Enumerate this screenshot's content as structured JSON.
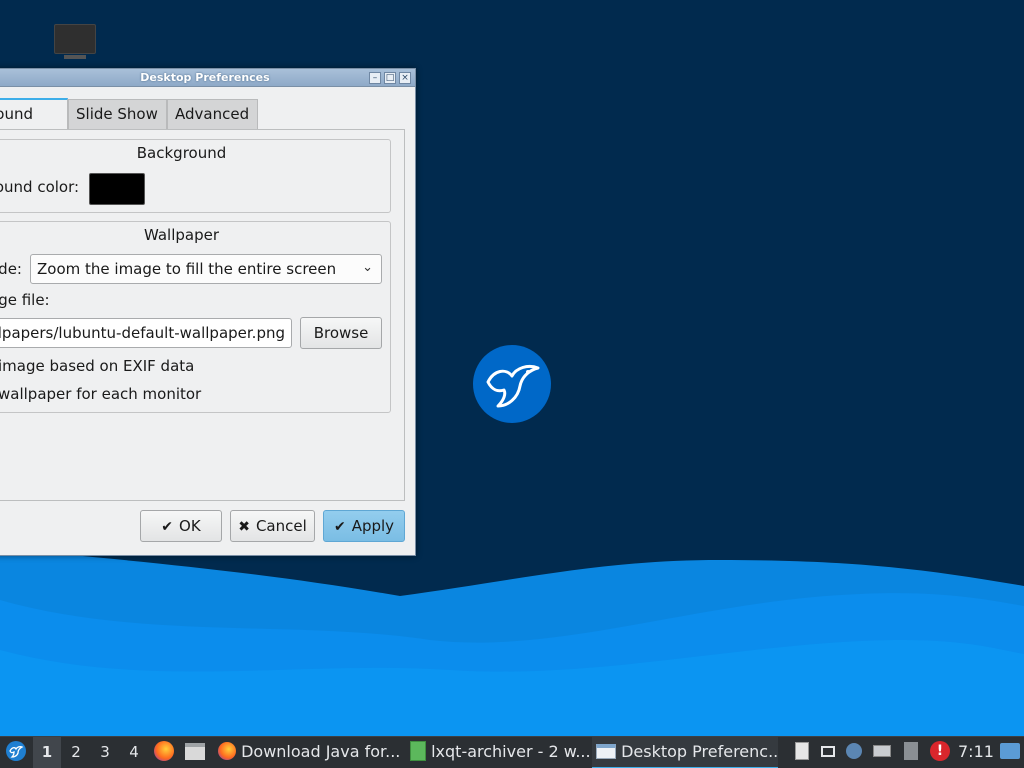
{
  "window": {
    "title": "Desktop Preferences",
    "controls": {
      "minimize": "–",
      "maximize": "□",
      "close": "×"
    }
  },
  "tabs": [
    {
      "label": "ckground",
      "active": true
    },
    {
      "label": "Slide Show",
      "active": false
    },
    {
      "label": "Advanced",
      "active": false
    }
  ],
  "background_group": {
    "title": "Background",
    "color_label": "round color:",
    "color_value": "#000000"
  },
  "wallpaper_group": {
    "title": "Wallpaper",
    "mode_label": "ode:",
    "mode_value": "Zoom the image to fill the entire screen",
    "file_label": "age file:",
    "file_value": "llpapers/lubuntu-default-wallpaper.png",
    "browse_label": "Browse",
    "exif_label": "image based on EXIF data",
    "per_monitor_label": "wallpaper for each monitor"
  },
  "dialog_buttons": {
    "ok": "OK",
    "cancel": "Cancel",
    "apply": "Apply"
  },
  "taskbar": {
    "workspaces": [
      "1",
      "2",
      "3",
      "4"
    ],
    "active_workspace": "1",
    "tasks": [
      {
        "label": "Download Java for...",
        "icon": "firefox-icon",
        "active": false
      },
      {
        "label": "lxqt-archiver - 2 w...",
        "icon": "archive-icon",
        "active": false
      },
      {
        "label": "Desktop Preferenc...",
        "icon": "window-icon",
        "active": true
      }
    ],
    "clock": "7:11"
  },
  "colors": {
    "desktop": "#012a4e",
    "wave_light": "#0b8fe8",
    "wave_dark": "#0572c9",
    "accent": "#3daee9",
    "apply": "#7abde4"
  }
}
